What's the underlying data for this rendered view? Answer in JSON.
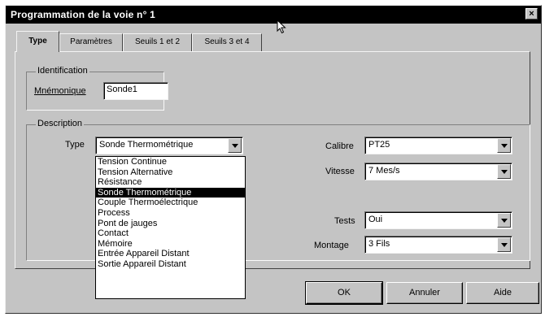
{
  "window": {
    "title": "Programmation de la voie n° 1",
    "close_glyph": "×"
  },
  "tabs": [
    {
      "label": "Type"
    },
    {
      "label": "Paramètres"
    },
    {
      "label": "Seuils 1 et 2"
    },
    {
      "label": "Seuils 3 et 4"
    }
  ],
  "identification": {
    "group_label": "Identification",
    "mnemonique_label": "Mnémonique",
    "mnemonique_value": "Sonde1"
  },
  "description": {
    "group_label": "Description",
    "type_label": "Type",
    "type_value": "Sonde Thermométrique",
    "type_options": [
      "Tension Continue",
      "Tension Alternative",
      "Résistance",
      "Sonde Thermométrique",
      "Couple Thermoélectrique",
      "Process",
      "Pont de jauges",
      "Contact",
      "Mémoire",
      "Entrée Appareil Distant",
      "Sortie Appareil Distant"
    ],
    "calibre_label": "Calibre",
    "calibre_value": "PT25",
    "vitesse_label": "Vitesse",
    "vitesse_value": "7 Mes/s",
    "tests_label": "Tests",
    "tests_value": "Oui",
    "montage_label": "Montage",
    "montage_value": "3 Fils"
  },
  "buttons": {
    "ok": "OK",
    "annuler": "Annuler",
    "aide": "Aide"
  }
}
